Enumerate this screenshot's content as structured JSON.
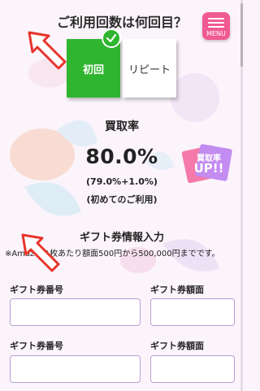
{
  "header": {
    "question": "ご利用回数は何回目？"
  },
  "menu": {
    "label": "MENU"
  },
  "usage_options": [
    {
      "label": "初回",
      "selected": true
    },
    {
      "label": "リピート",
      "selected": false
    }
  ],
  "rate": {
    "title": "買取率",
    "value": "80.0%",
    "detail": "(79.0%+1.0%)",
    "note": "(初めてのご利用)"
  },
  "badge": {
    "line1": "買取率",
    "line2": "UP!!"
  },
  "gift": {
    "title": "ギフト券情報入力",
    "notice": "※Amazon1枚あたり額面500円から500,000円までです。"
  },
  "rows": [
    {
      "number_label": "ギフト券番号",
      "number_value": "",
      "amount_label": "ギフト券額面",
      "amount_value": ""
    },
    {
      "number_label": "ギフト券番号",
      "number_value": "",
      "amount_label": "ギフト券額面",
      "amount_value": ""
    }
  ],
  "colors": {
    "accent_green": "#2fb52f",
    "menu_pink": "#f05a92",
    "arrow_red": "#e8342b"
  }
}
